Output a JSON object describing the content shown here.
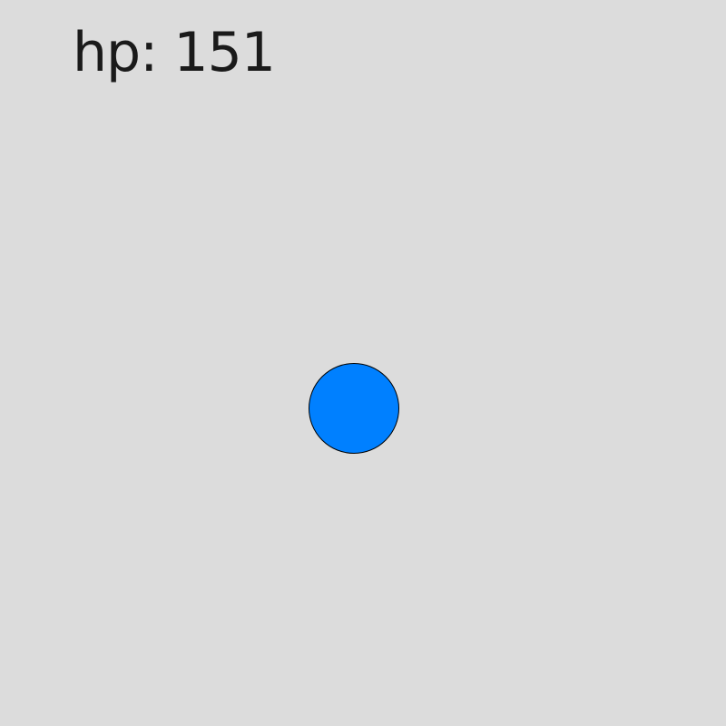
{
  "hud": {
    "hp_prefix": "hp: ",
    "hp_value": "151"
  },
  "player": {
    "shape": "circle",
    "fill_color": "#0080ff",
    "outline_color": "#000000"
  },
  "background_color": "#dcdcdc"
}
